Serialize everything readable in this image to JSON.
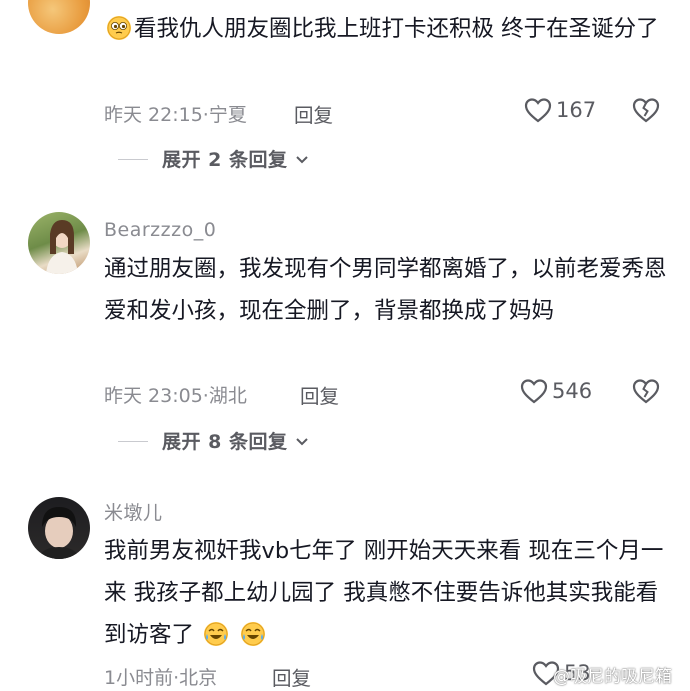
{
  "comments": [
    {
      "text": "看我仇人朋友圈比我上班打卡还积极 终于在圣诞分了",
      "time": "昨天 22:15",
      "location": "宁夏",
      "reply_label": "回复",
      "likes": "167",
      "expand": "展开 2 条回复",
      "emoji": "eyes-emoji"
    },
    {
      "username": "Bearzzzo_0",
      "text": "通过朋友圈，我发现有个男同学都离婚了，以前老爱秀恩爱和发小孩，现在全删了，背景都换成了妈妈",
      "time": "昨天 23:05",
      "location": "湖北",
      "reply_label": "回复",
      "likes": "546",
      "expand": "展开 8 条回复"
    },
    {
      "username": "米墩儿",
      "text": "我前男友视奸我vb七年了 刚开始天天来看 现在三个月一来 我孩子都上幼儿园了 我真憋不住要告诉他其实我能看到访客了",
      "time": "1小时前",
      "location": "北京",
      "reply_label": "回复",
      "likes": "53",
      "emoji": "tears-of-joy-emoji"
    }
  ],
  "separator": "·",
  "watermark": "@吸尼的吸尼箱"
}
